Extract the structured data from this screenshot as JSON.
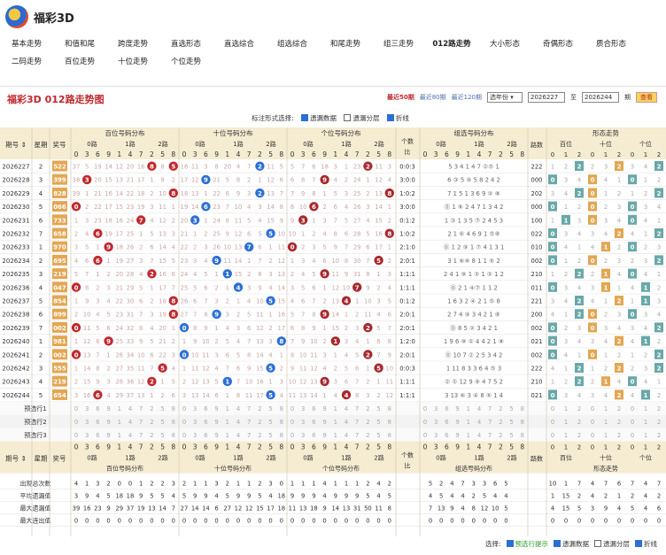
{
  "site": {
    "title": "福彩3D"
  },
  "nav": {
    "row1": [
      "基本走势",
      "和值和尾",
      "跨度走势",
      "直选形态",
      "直选综合",
      "组选综合",
      "和尾走势",
      "组三走势",
      "012路走势",
      "大小形态",
      "奇偶形态",
      "质合形态"
    ],
    "row2": [
      "二码走势",
      "百位走势",
      "十位走势",
      "个位走势"
    ],
    "active": "012路走势"
  },
  "panel": {
    "title": "福彩3D 012路走势图",
    "filters": {
      "last50": "最近50期",
      "last80": "最近80期",
      "last120": "最近120期",
      "select": "选年份",
      "from": "2026227",
      "to_label": "至",
      "to": "2026244",
      "period_label": "期",
      "query": "查看"
    },
    "options_label": "标注形式选择:",
    "options": [
      "遗漏数据",
      "遗漏分层",
      "折线"
    ],
    "options_checked": [
      true,
      false,
      true
    ]
  },
  "headers": {
    "qihao": "期号 ⇕",
    "xingqi": "星期",
    "jianghao": "奖号",
    "bai": "百位号码分布",
    "shi": "十位号码分布",
    "ge": "个位号码分布",
    "geshu": "个数比",
    "zuxuan": "组选号码分布",
    "lushu": "路数",
    "xingtai": "形态走势",
    "routes": [
      "0路",
      "1路",
      "2路"
    ],
    "digits": [
      "0",
      "3",
      "6",
      "9",
      "1",
      "4",
      "7",
      "2",
      "5",
      "8"
    ],
    "zx_digits": [
      "0",
      "3",
      "6",
      "9",
      "1",
      "4",
      "7",
      "2",
      "5",
      "8"
    ],
    "xt_groups": [
      "百位",
      "十位",
      "个位"
    ],
    "xt_digits": [
      "0",
      "1",
      "2",
      "0",
      "1",
      "2",
      "0",
      "1",
      "2"
    ]
  },
  "rows": [
    {
      "q": "2026227",
      "w": "2",
      "n": "522",
      "r": "0:0:3",
      "l": "222",
      "b": [
        37,
        5,
        19,
        14,
        12,
        20,
        16,
        "8",
        8,
        "5"
      ],
      "s": [
        16,
        11,
        3,
        8,
        20,
        4,
        7,
        "2",
        11,
        5
      ],
      "g": [
        5,
        7,
        6,
        18,
        3,
        1,
        23,
        "2",
        11,
        3
      ],
      "z": "5 3 4 1 4 7 ②⑤ 1"
    },
    {
      "q": "2026228",
      "w": "3",
      "n": "399",
      "r": "3:0:0",
      "l": "000",
      "b": [
        38,
        "3",
        20,
        15,
        13,
        21,
        17,
        1,
        9,
        2
      ],
      "s": [
        17,
        12,
        "9",
        21,
        5,
        8,
        2,
        1,
        12,
        6
      ],
      "g": [
        6,
        8,
        7,
        "9",
        4,
        2,
        24,
        1,
        12,
        4
      ],
      "z": "6 ③ 5 ⑨ 5 8 2 4 2"
    },
    {
      "q": "2026229",
      "w": "4",
      "n": "828",
      "r": "1:0:2",
      "l": "202",
      "b": [
        39,
        1,
        21,
        16,
        14,
        22,
        18,
        2,
        10,
        "8"
      ],
      "s": [
        18,
        13,
        1,
        22,
        6,
        9,
        3,
        "2",
        13,
        7
      ],
      "g": [
        7,
        9,
        8,
        1,
        5,
        3,
        25,
        2,
        13,
        "8"
      ],
      "z": "7 1 5 1 3 6 9 ② ⑧"
    },
    {
      "q": "2026230",
      "w": "5",
      "n": "066",
      "r": "3:0:0",
      "l": "000",
      "b": [
        "0",
        2,
        22,
        17,
        15,
        23,
        19,
        3,
        11,
        1
      ],
      "s": [
        19,
        14,
        "6",
        23,
        7,
        10,
        4,
        3,
        14,
        8
      ],
      "g": [
        8,
        10,
        "6",
        2,
        6,
        4,
        26,
        3,
        14,
        1
      ],
      "z": "⓪ 1 ⑥ 2 4 7 1 3 4 2"
    },
    {
      "q": "2026231",
      "w": "6",
      "n": "733",
      "r": "0:1:2",
      "l": "100",
      "b": [
        1,
        3,
        23,
        18,
        16,
        24,
        "7",
        4,
        12,
        2
      ],
      "s": [
        20,
        "3",
        1,
        24,
        8,
        11,
        5,
        4,
        15,
        9
      ],
      "g": [
        9,
        "3",
        1,
        3,
        7,
        5,
        27,
        4,
        15,
        2
      ],
      "z": "1 ③ 1 3 5 ⑦ 2 4 5 3"
    },
    {
      "q": "2026232",
      "w": "7",
      "n": "658",
      "r": "1:0:2",
      "l": "022",
      "b": [
        2,
        4,
        "6",
        19,
        17,
        25,
        1,
        5,
        13,
        3
      ],
      "s": [
        21,
        1,
        2,
        25,
        9,
        12,
        6,
        5,
        "5",
        10
      ],
      "g": [
        10,
        1,
        2,
        4,
        8,
        6,
        28,
        5,
        16,
        "8"
      ],
      "z": "2 1 ⑥ 4 6 9 1 ⑤⑧"
    },
    {
      "q": "2026233",
      "w": "1",
      "n": "970",
      "r": "2:1:0",
      "l": "010",
      "b": [
        3,
        5,
        1,
        "9",
        18,
        26,
        2,
        6,
        14,
        4
      ],
      "s": [
        22,
        2,
        3,
        26,
        10,
        13,
        "7",
        6,
        1,
        11
      ],
      "g": [
        "0",
        2,
        3,
        5,
        9,
        7,
        29,
        6,
        17,
        1
      ],
      "z": "⓪ 1 2 ⑨ 1 ⑦ 4 1 3 1"
    },
    {
      "q": "2026234",
      "w": "2",
      "n": "695",
      "r": "2:0:1",
      "l": "002",
      "b": [
        4,
        6,
        "6",
        1,
        19,
        27,
        3,
        7,
        15,
        5
      ],
      "s": [
        23,
        3,
        4,
        "9",
        11,
        14,
        1,
        7,
        2,
        12
      ],
      "g": [
        1,
        3,
        4,
        6,
        10,
        8,
        30,
        7,
        "5",
        2
      ],
      "z": "3 1 ⑥⑨ 8 1 1 ⑤ 2"
    },
    {
      "q": "2026235",
      "w": "3",
      "n": "219",
      "r": "1:1:1",
      "l": "210",
      "b": [
        5,
        7,
        1,
        2,
        20,
        28,
        4,
        "2",
        16,
        6
      ],
      "s": [
        24,
        4,
        5,
        1,
        "1",
        15,
        2,
        8,
        3,
        13
      ],
      "g": [
        2,
        4,
        5,
        "9",
        11,
        9,
        31,
        8,
        1,
        3
      ],
      "z": "2 4 1 ⑨ 1 ① 1 ② 1 2"
    },
    {
      "q": "2026236",
      "w": "4",
      "n": "047",
      "r": "1:1:1",
      "l": "011",
      "b": [
        "0",
        8,
        2,
        3,
        21,
        29,
        5,
        1,
        17,
        7
      ],
      "s": [
        25,
        5,
        6,
        2,
        1,
        "4",
        3,
        9,
        4,
        14
      ],
      "g": [
        3,
        5,
        6,
        1,
        12,
        10,
        "7",
        9,
        2,
        4
      ],
      "z": "⓪ 2 1 ④⑦ 1 1 2"
    },
    {
      "q": "2026237",
      "w": "5",
      "n": "854",
      "r": "0:1:2",
      "l": "221",
      "b": [
        1,
        9,
        3,
        4,
        22,
        30,
        6,
        2,
        18,
        "8"
      ],
      "s": [
        26,
        6,
        7,
        3,
        2,
        1,
        4,
        10,
        "5",
        15
      ],
      "g": [
        4,
        6,
        7,
        2,
        13,
        "4",
        1,
        10,
        3,
        5
      ],
      "z": "1 6 3 2 ④ 2 1 ⑤ 8"
    },
    {
      "q": "2026238",
      "w": "6",
      "n": "899",
      "r": "2:0:1",
      "l": "200",
      "b": [
        2,
        10,
        4,
        5,
        23,
        31,
        7,
        3,
        19,
        "8"
      ],
      "s": [
        27,
        7,
        8,
        "9",
        3,
        2,
        5,
        11,
        1,
        16
      ],
      "g": [
        5,
        7,
        8,
        "9",
        14,
        1,
        2,
        11,
        4,
        6
      ],
      "z": "2 7 4 ⑨ 3 4 2 1 ⑧"
    },
    {
      "q": "2026239",
      "w": "7",
      "n": "002",
      "r": "2:0:1",
      "l": "002",
      "b": [
        "0",
        11,
        5,
        6,
        24,
        32,
        8,
        4,
        20,
        1
      ],
      "s": [
        "0",
        8,
        9,
        1,
        4,
        3,
        6,
        12,
        2,
        17
      ],
      "g": [
        6,
        8,
        9,
        1,
        15,
        2,
        3,
        "2",
        5,
        7
      ],
      "z": "⓪ 8 5 ② 3 4 2 1"
    },
    {
      "q": "2026240",
      "w": "1",
      "n": "981",
      "r": "1:2:0",
      "l": "021",
      "b": [
        1,
        12,
        6,
        "9",
        25,
        33,
        9,
        5,
        21,
        2
      ],
      "s": [
        1,
        9,
        10,
        2,
        5,
        4,
        7,
        13,
        3,
        "8"
      ],
      "g": [
        7,
        9,
        10,
        2,
        "1",
        3,
        4,
        1,
        6,
        8
      ],
      "z": "1 9 6 ⑨ ① 4 4 2 1 ⑧"
    },
    {
      "q": "2026241",
      "w": "2",
      "n": "002",
      "r": "2:0:1",
      "l": "002",
      "b": [
        "0",
        13,
        7,
        1,
        26,
        34,
        10,
        6,
        22,
        3
      ],
      "s": [
        "0",
        10,
        11,
        3,
        6,
        5,
        8,
        14,
        4,
        1
      ],
      "g": [
        8,
        10,
        11,
        3,
        1,
        4,
        5,
        "2",
        7,
        9
      ],
      "z": "⓪ 10 7 ② 2 5 3 4 2"
    },
    {
      "q": "2026242",
      "w": "3",
      "n": "555",
      "r": "0:0:3",
      "l": "222",
      "b": [
        1,
        14,
        8,
        2,
        27,
        35,
        11,
        7,
        "5",
        4
      ],
      "s": [
        1,
        11,
        12,
        4,
        7,
        6,
        9,
        15,
        "5",
        2
      ],
      "g": [
        9,
        11,
        12,
        4,
        2,
        5,
        6,
        1,
        "5",
        10
      ],
      "z": "1 11 8 3 3 6 4 ⑤ 3"
    },
    {
      "q": "2026243",
      "w": "4",
      "n": "219",
      "r": "1:1:1",
      "l": "210",
      "b": [
        2,
        15,
        9,
        3,
        28,
        36,
        12,
        "2",
        1,
        5
      ],
      "s": [
        2,
        12,
        13,
        5,
        "1",
        7,
        10,
        16,
        1,
        3
      ],
      "g": [
        10,
        12,
        13,
        "9",
        3,
        6,
        7,
        2,
        1,
        11
      ],
      "z": "② ① 12 9 ⑨ 4 7 5 2"
    },
    {
      "q": "2026244",
      "w": "5",
      "n": "654",
      "r": "1:1:1",
      "l": "021",
      "b": [
        3,
        16,
        "6",
        4,
        29,
        37,
        13,
        1,
        2,
        6
      ],
      "s": [
        3,
        13,
        14,
        6,
        1,
        8,
        11,
        17,
        "5",
        4
      ],
      "g": [
        11,
        13,
        14,
        1,
        4,
        "4",
        8,
        3,
        2,
        12
      ],
      "z": "3 13 ⑥ 3 ④ 8 ⑤ 1 4"
    }
  ],
  "predict_labels": [
    "预选行1",
    "预选行2",
    "预选行3"
  ],
  "stats": {
    "labels": [
      "出现总次数",
      "平均遗漏值",
      "最大遗漏值",
      "最大连出值"
    ],
    "bai": [
      [
        "4",
        "1",
        "3",
        "2",
        "0",
        "0",
        "1",
        "2",
        "2",
        "3"
      ],
      [
        "3",
        "9",
        "4",
        "5",
        "18",
        "18",
        "9",
        "5",
        "5",
        "4"
      ],
      [
        "39",
        "16",
        "23",
        "9",
        "29",
        "37",
        "19",
        "13",
        "14",
        "7"
      ],
      [
        "0",
        "0",
        "0",
        "0",
        "0",
        "0",
        "0",
        "0",
        "0",
        "0"
      ]
    ],
    "shi": [
      [
        "2",
        "1",
        "1",
        "3",
        "2",
        "1",
        "1",
        "2",
        "3",
        "0"
      ],
      [
        "5",
        "9",
        "9",
        "4",
        "5",
        "9",
        "9",
        "5",
        "4",
        "18"
      ],
      [
        "27",
        "14",
        "14",
        "6",
        "27",
        "12",
        "12",
        "15",
        "17",
        "18"
      ],
      [
        "0",
        "0",
        "0",
        "0",
        "0",
        "0",
        "0",
        "0",
        "0",
        "0"
      ]
    ],
    "ge": [
      [
        "1",
        "1",
        "1",
        "4",
        "1",
        "1",
        "1",
        "2",
        "4",
        "2"
      ],
      [
        "9",
        "9",
        "9",
        "4",
        "9",
        "9",
        "9",
        "5",
        "4",
        "5"
      ],
      [
        "11",
        "13",
        "18",
        "9",
        "14",
        "13",
        "31",
        "50",
        "11",
        "8"
      ],
      [
        "0",
        "0",
        "0",
        "0",
        "0",
        "0",
        "0",
        "0",
        "0",
        "0"
      ]
    ],
    "zx": [
      [
        "5",
        "2",
        "4",
        "7",
        "3",
        "3",
        "6",
        "5"
      ],
      [
        "4",
        "5",
        "4",
        "4",
        "2",
        "5",
        "4",
        "4"
      ],
      [
        "7",
        "13",
        "9",
        "4",
        "8",
        "12",
        "10",
        "5"
      ],
      [
        "0",
        "0",
        "0",
        "0",
        "0",
        "0",
        "0",
        "0"
      ]
    ],
    "xt": [
      [
        "10",
        "1",
        "7",
        "4",
        "7",
        "6",
        "7",
        "4",
        "7"
      ],
      [
        "1",
        "15",
        "2",
        "4",
        "2",
        "1",
        "2",
        "4",
        "2"
      ],
      [
        "4",
        "15",
        "5",
        "3",
        "9",
        "4",
        "5",
        "4",
        "6"
      ],
      [
        "0",
        "0",
        "0",
        "0",
        "0",
        "0",
        "0",
        "0",
        "0"
      ]
    ]
  },
  "bottom_options": {
    "label": "选择:",
    "items": [
      "预选行提示",
      "遗漏数据",
      "遗漏分层",
      "折线"
    ],
    "checked": [
      true,
      true,
      false,
      true
    ]
  }
}
